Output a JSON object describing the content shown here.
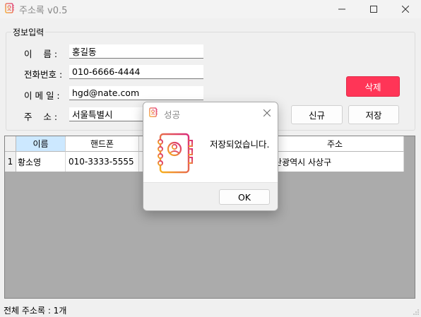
{
  "window": {
    "title": "주소록 v0.5"
  },
  "form": {
    "group_title": "정보입력",
    "name_label": "이    름 :",
    "name_value": "홍길동",
    "phone_label": "전화번호 :",
    "phone_value": "010-6666-4444",
    "email_label": "이 메 일 :",
    "email_value": "hgd@nate.com",
    "address_label": "주    소 :",
    "address_value": "서울특별시"
  },
  "buttons": {
    "delete": "삭제",
    "new": "신규",
    "save": "저장"
  },
  "grid": {
    "columns": [
      "이름",
      "핸드폰",
      "",
      "주소"
    ],
    "selected_column": "이름",
    "rows": [
      {
        "index": "1",
        "name": "황소영",
        "phone": "010-3333-5555",
        "email": "",
        "address": "부산광역시 사상구"
      }
    ]
  },
  "status": {
    "text": "전체 주소록 : 1개"
  },
  "dialog": {
    "title": "성공",
    "message": "저장되었습니다.",
    "ok": "OK"
  },
  "colors": {
    "delete_button": "#ff3557",
    "selected_header": "#cce8ff"
  },
  "icons": {
    "app": "address-book-icon",
    "dialog": "address-book-icon",
    "close": "close-icon"
  }
}
